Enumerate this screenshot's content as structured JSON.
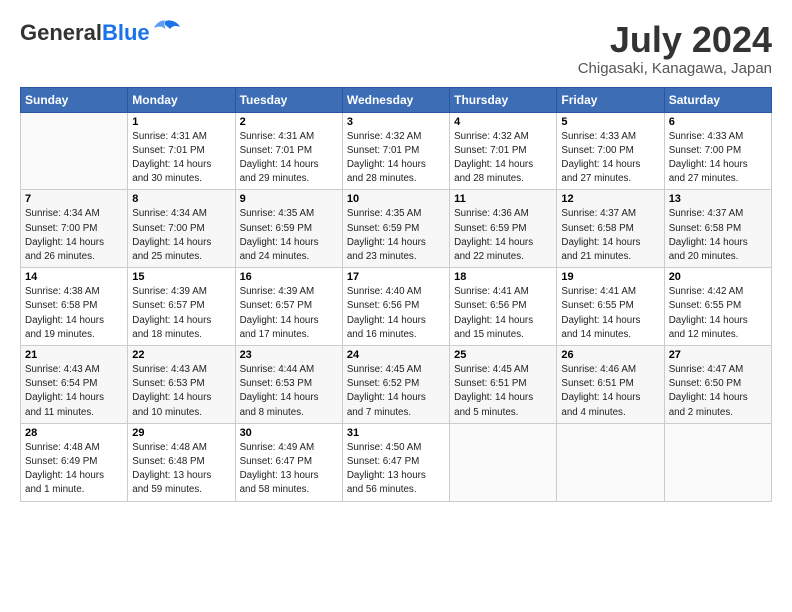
{
  "header": {
    "logo_general": "General",
    "logo_blue": "Blue",
    "month_year": "July 2024",
    "location": "Chigasaki, Kanagawa, Japan"
  },
  "calendar": {
    "headers": [
      "Sunday",
      "Monday",
      "Tuesday",
      "Wednesday",
      "Thursday",
      "Friday",
      "Saturday"
    ],
    "weeks": [
      [
        {
          "day": "",
          "info": ""
        },
        {
          "day": "1",
          "info": "Sunrise: 4:31 AM\nSunset: 7:01 PM\nDaylight: 14 hours\nand 30 minutes."
        },
        {
          "day": "2",
          "info": "Sunrise: 4:31 AM\nSunset: 7:01 PM\nDaylight: 14 hours\nand 29 minutes."
        },
        {
          "day": "3",
          "info": "Sunrise: 4:32 AM\nSunset: 7:01 PM\nDaylight: 14 hours\nand 28 minutes."
        },
        {
          "day": "4",
          "info": "Sunrise: 4:32 AM\nSunset: 7:01 PM\nDaylight: 14 hours\nand 28 minutes."
        },
        {
          "day": "5",
          "info": "Sunrise: 4:33 AM\nSunset: 7:00 PM\nDaylight: 14 hours\nand 27 minutes."
        },
        {
          "day": "6",
          "info": "Sunrise: 4:33 AM\nSunset: 7:00 PM\nDaylight: 14 hours\nand 27 minutes."
        }
      ],
      [
        {
          "day": "7",
          "info": "Sunrise: 4:34 AM\nSunset: 7:00 PM\nDaylight: 14 hours\nand 26 minutes."
        },
        {
          "day": "8",
          "info": "Sunrise: 4:34 AM\nSunset: 7:00 PM\nDaylight: 14 hours\nand 25 minutes."
        },
        {
          "day": "9",
          "info": "Sunrise: 4:35 AM\nSunset: 6:59 PM\nDaylight: 14 hours\nand 24 minutes."
        },
        {
          "day": "10",
          "info": "Sunrise: 4:35 AM\nSunset: 6:59 PM\nDaylight: 14 hours\nand 23 minutes."
        },
        {
          "day": "11",
          "info": "Sunrise: 4:36 AM\nSunset: 6:59 PM\nDaylight: 14 hours\nand 22 minutes."
        },
        {
          "day": "12",
          "info": "Sunrise: 4:37 AM\nSunset: 6:58 PM\nDaylight: 14 hours\nand 21 minutes."
        },
        {
          "day": "13",
          "info": "Sunrise: 4:37 AM\nSunset: 6:58 PM\nDaylight: 14 hours\nand 20 minutes."
        }
      ],
      [
        {
          "day": "14",
          "info": "Sunrise: 4:38 AM\nSunset: 6:58 PM\nDaylight: 14 hours\nand 19 minutes."
        },
        {
          "day": "15",
          "info": "Sunrise: 4:39 AM\nSunset: 6:57 PM\nDaylight: 14 hours\nand 18 minutes."
        },
        {
          "day": "16",
          "info": "Sunrise: 4:39 AM\nSunset: 6:57 PM\nDaylight: 14 hours\nand 17 minutes."
        },
        {
          "day": "17",
          "info": "Sunrise: 4:40 AM\nSunset: 6:56 PM\nDaylight: 14 hours\nand 16 minutes."
        },
        {
          "day": "18",
          "info": "Sunrise: 4:41 AM\nSunset: 6:56 PM\nDaylight: 14 hours\nand 15 minutes."
        },
        {
          "day": "19",
          "info": "Sunrise: 4:41 AM\nSunset: 6:55 PM\nDaylight: 14 hours\nand 14 minutes."
        },
        {
          "day": "20",
          "info": "Sunrise: 4:42 AM\nSunset: 6:55 PM\nDaylight: 14 hours\nand 12 minutes."
        }
      ],
      [
        {
          "day": "21",
          "info": "Sunrise: 4:43 AM\nSunset: 6:54 PM\nDaylight: 14 hours\nand 11 minutes."
        },
        {
          "day": "22",
          "info": "Sunrise: 4:43 AM\nSunset: 6:53 PM\nDaylight: 14 hours\nand 10 minutes."
        },
        {
          "day": "23",
          "info": "Sunrise: 4:44 AM\nSunset: 6:53 PM\nDaylight: 14 hours\nand 8 minutes."
        },
        {
          "day": "24",
          "info": "Sunrise: 4:45 AM\nSunset: 6:52 PM\nDaylight: 14 hours\nand 7 minutes."
        },
        {
          "day": "25",
          "info": "Sunrise: 4:45 AM\nSunset: 6:51 PM\nDaylight: 14 hours\nand 5 minutes."
        },
        {
          "day": "26",
          "info": "Sunrise: 4:46 AM\nSunset: 6:51 PM\nDaylight: 14 hours\nand 4 minutes."
        },
        {
          "day": "27",
          "info": "Sunrise: 4:47 AM\nSunset: 6:50 PM\nDaylight: 14 hours\nand 2 minutes."
        }
      ],
      [
        {
          "day": "28",
          "info": "Sunrise: 4:48 AM\nSunset: 6:49 PM\nDaylight: 14 hours\nand 1 minute."
        },
        {
          "day": "29",
          "info": "Sunrise: 4:48 AM\nSunset: 6:48 PM\nDaylight: 13 hours\nand 59 minutes."
        },
        {
          "day": "30",
          "info": "Sunrise: 4:49 AM\nSunset: 6:47 PM\nDaylight: 13 hours\nand 58 minutes."
        },
        {
          "day": "31",
          "info": "Sunrise: 4:50 AM\nSunset: 6:47 PM\nDaylight: 13 hours\nand 56 minutes."
        },
        {
          "day": "",
          "info": ""
        },
        {
          "day": "",
          "info": ""
        },
        {
          "day": "",
          "info": ""
        }
      ]
    ]
  }
}
